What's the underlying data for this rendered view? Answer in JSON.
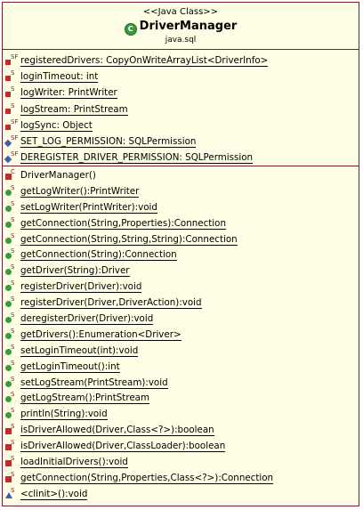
{
  "class": {
    "stereotype": "<<Java Class>>",
    "name": "DriverManager",
    "package": "java.sql",
    "icon": "class-icon-green-c"
  },
  "colors": {
    "box_fill": "#ffffe6",
    "box_border": "#7a1c2c",
    "private_icon": "#c42a2a",
    "public_icon": "#3c9a3c",
    "package_icon": "#3d5fb0"
  },
  "fields": [
    {
      "text": "registeredDrivers: CopyOnWriteArrayList<DriverInfo>",
      "vis": "private",
      "mods": "SF",
      "underline": true
    },
    {
      "text": "loginTimeout: int",
      "vis": "private",
      "mods": "S",
      "underline": true
    },
    {
      "text": "logWriter: PrintWriter",
      "vis": "private",
      "mods": "S",
      "underline": true
    },
    {
      "text": "logStream: PrintStream",
      "vis": "private",
      "mods": "S",
      "underline": true
    },
    {
      "text": "logSync: Object",
      "vis": "private",
      "mods": "SF",
      "underline": true
    },
    {
      "text": "SET_LOG_PERMISSION: SQLPermission",
      "vis": "package",
      "mods": "SF",
      "underline": true
    },
    {
      "text": "DEREGISTER_DRIVER_PERMISSION: SQLPermission",
      "vis": "package",
      "mods": "SF",
      "underline": true
    }
  ],
  "methods": [
    {
      "text": "DriverManager()",
      "vis": "private",
      "mods": "C",
      "underline": false
    },
    {
      "text": "getLogWriter():PrintWriter",
      "vis": "public",
      "mods": "S",
      "underline": true
    },
    {
      "text": "setLogWriter(PrintWriter):void",
      "vis": "public",
      "mods": "S",
      "underline": true
    },
    {
      "text": "getConnection(String,Properties):Connection",
      "vis": "public",
      "mods": "S",
      "underline": true
    },
    {
      "text": "getConnection(String,String,String):Connection",
      "vis": "public",
      "mods": "S",
      "underline": true
    },
    {
      "text": "getConnection(String):Connection",
      "vis": "public",
      "mods": "S",
      "underline": true
    },
    {
      "text": "getDriver(String):Driver",
      "vis": "public",
      "mods": "S",
      "underline": true
    },
    {
      "text": "registerDriver(Driver):void",
      "vis": "public",
      "mods": "S",
      "underline": true
    },
    {
      "text": "registerDriver(Driver,DriverAction):void",
      "vis": "public",
      "mods": "S",
      "underline": true
    },
    {
      "text": "deregisterDriver(Driver):void",
      "vis": "public",
      "mods": "S",
      "underline": true
    },
    {
      "text": "getDrivers():Enumeration<Driver>",
      "vis": "public",
      "mods": "S",
      "underline": true
    },
    {
      "text": "setLoginTimeout(int):void",
      "vis": "public",
      "mods": "S",
      "underline": true
    },
    {
      "text": "getLoginTimeout():int",
      "vis": "public",
      "mods": "S",
      "underline": true
    },
    {
      "text": "setLogStream(PrintStream):void",
      "vis": "public",
      "mods": "S",
      "underline": true
    },
    {
      "text": "getLogStream():PrintStream",
      "vis": "public",
      "mods": "S",
      "underline": true
    },
    {
      "text": "println(String):void",
      "vis": "public",
      "mods": "S",
      "underline": true
    },
    {
      "text": "isDriverAllowed(Driver,Class<?>):boolean",
      "vis": "private",
      "mods": "S",
      "underline": true
    },
    {
      "text": "isDriverAllowed(Driver,ClassLoader):boolean",
      "vis": "private",
      "mods": "S",
      "underline": true
    },
    {
      "text": "loadInitialDrivers():void",
      "vis": "private",
      "mods": "S",
      "underline": true
    },
    {
      "text": "getConnection(String,Properties,Class<?>):Connection",
      "vis": "private",
      "mods": "S",
      "underline": true
    },
    {
      "text": "<clinit>():void",
      "vis": "package",
      "mods": "S",
      "underline": true
    }
  ]
}
